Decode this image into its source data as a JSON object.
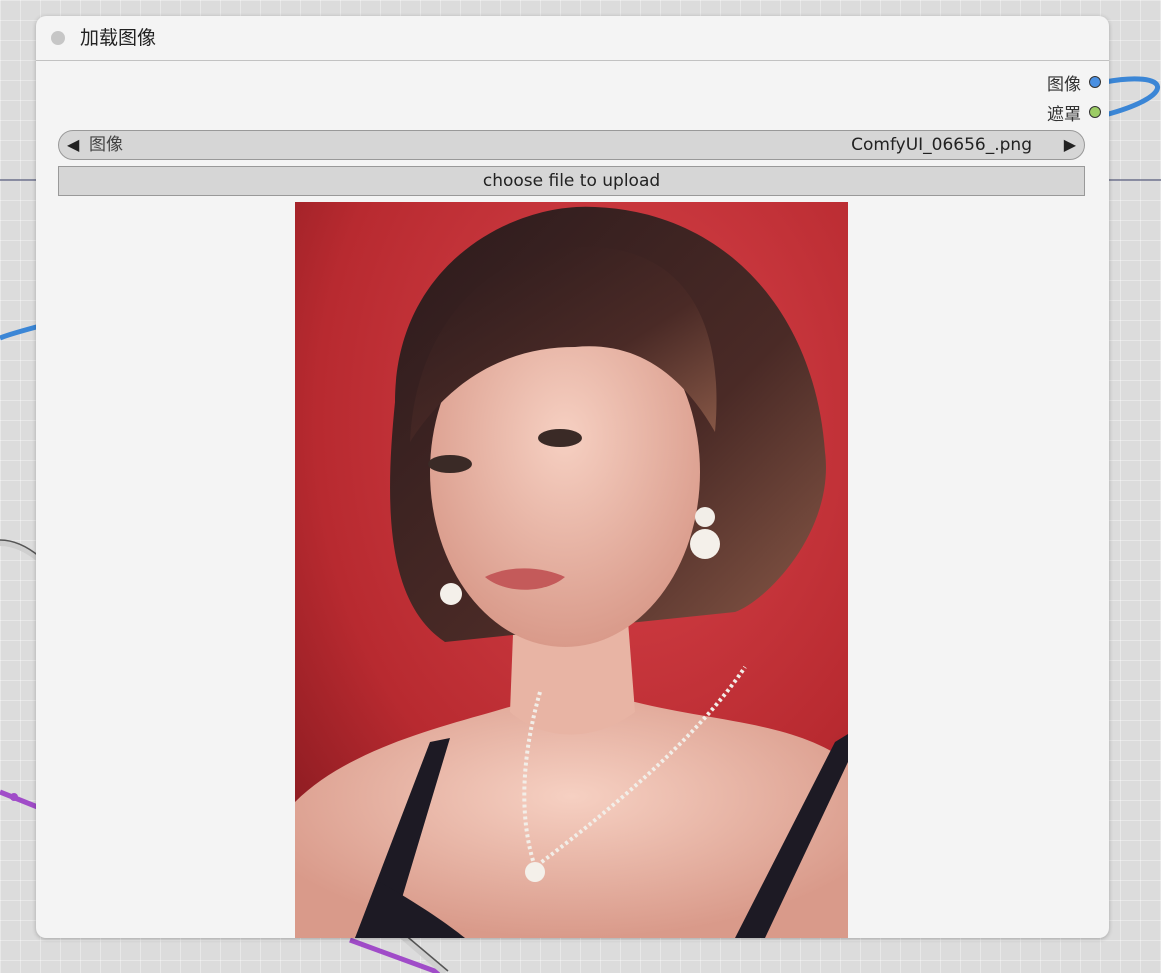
{
  "node": {
    "title": "加载图像",
    "outputs": [
      {
        "label": "图像",
        "color": "#4a90e2"
      },
      {
        "label": "遮罩",
        "color": "#9ccc65"
      }
    ]
  },
  "image_widget": {
    "label": "图像",
    "value": "ComfyUI_06656_.png"
  },
  "upload_button": {
    "label": "choose file to upload"
  },
  "preview": {
    "icon": "portrait-photo-icon"
  },
  "colors": {
    "canvas_background": "#dcdcdc",
    "node_background": "#f4f4f4",
    "wire_blue": "#3b86d6",
    "wire_purple": "#a04cc8",
    "wire_gray": "#cfcfcf",
    "wire_dark": "#6b6f8a"
  }
}
